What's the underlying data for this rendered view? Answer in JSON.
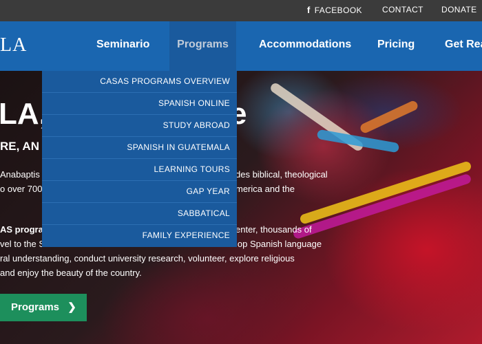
{
  "topbar": {
    "facebook_label": "FACEBOOK",
    "contact_label": "CONTACT",
    "donate_label": "DONATE",
    "facebook_icon": "f"
  },
  "logo": {
    "text": "LA"
  },
  "nav": {
    "items": [
      "Seminario",
      "Programs",
      "Accommodations",
      "Pricing",
      "Get Rea"
    ]
  },
  "dropdown": {
    "items": [
      "CASAS PROGRAMS OVERVIEW",
      "SPANISH ONLINE",
      "STUDY ABROAD",
      "SPANISH IN GUATEMALA",
      "LEARNING TOURS",
      "GAP YEAR",
      "SABBATICAL",
      "FAMILY EXPERIENCE"
    ]
  },
  "hero": {
    "heading": "LA,",
    "heading_tail": "e",
    "subheading": "RE, AN",
    "para1": [
      {
        "left": " Anabaptis",
        "right": "des biblical, theological"
      },
      {
        "left": "o over 700",
        "right": "merica and the"
      }
    ],
    "para2": [
      {
        "left": "AS program",
        "right": "enter, thousands of"
      },
      {
        "left": "vel to the S",
        "right": "lop Spanish language"
      },
      {
        "left": "ral understanding, conduct university research, volunteer, explore religious",
        "right": ""
      },
      {
        "left": "and enjoy the beauty of the country.",
        "right": ""
      }
    ],
    "button_label": "Programs",
    "button_icon": "❯"
  },
  "colors": {
    "topbar": "#3b3b3b",
    "nav": "#1a66b0",
    "dropdown": "#1a5a9d",
    "button": "#1d8f5c"
  }
}
